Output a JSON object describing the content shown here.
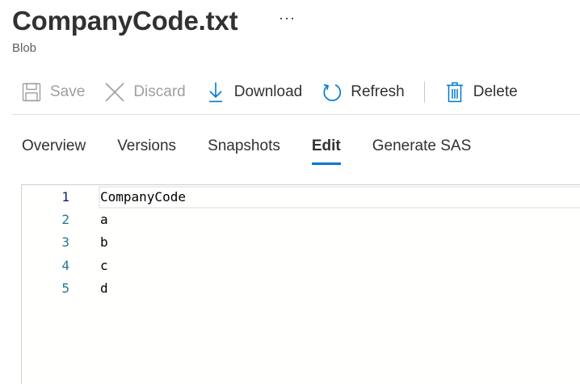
{
  "header": {
    "title": "CompanyCode.txt",
    "more_label": "···",
    "subtitle": "Blob"
  },
  "toolbar": {
    "save_label": "Save",
    "discard_label": "Discard",
    "download_label": "Download",
    "refresh_label": "Refresh",
    "delete_label": "Delete"
  },
  "tabs": [
    {
      "label": "Overview",
      "active": false
    },
    {
      "label": "Versions",
      "active": false
    },
    {
      "label": "Snapshots",
      "active": false
    },
    {
      "label": "Edit",
      "active": true
    },
    {
      "label": "Generate SAS",
      "active": false
    }
  ],
  "editor": {
    "lines": [
      {
        "number": "1",
        "text": "CompanyCode"
      },
      {
        "number": "2",
        "text": "a"
      },
      {
        "number": "3",
        "text": "b"
      },
      {
        "number": "4",
        "text": "c"
      },
      {
        "number": "5",
        "text": "d"
      }
    ]
  },
  "colors": {
    "accent": "#0078d4",
    "line_number": "#237893",
    "disabled_text": "#a19f9d"
  }
}
